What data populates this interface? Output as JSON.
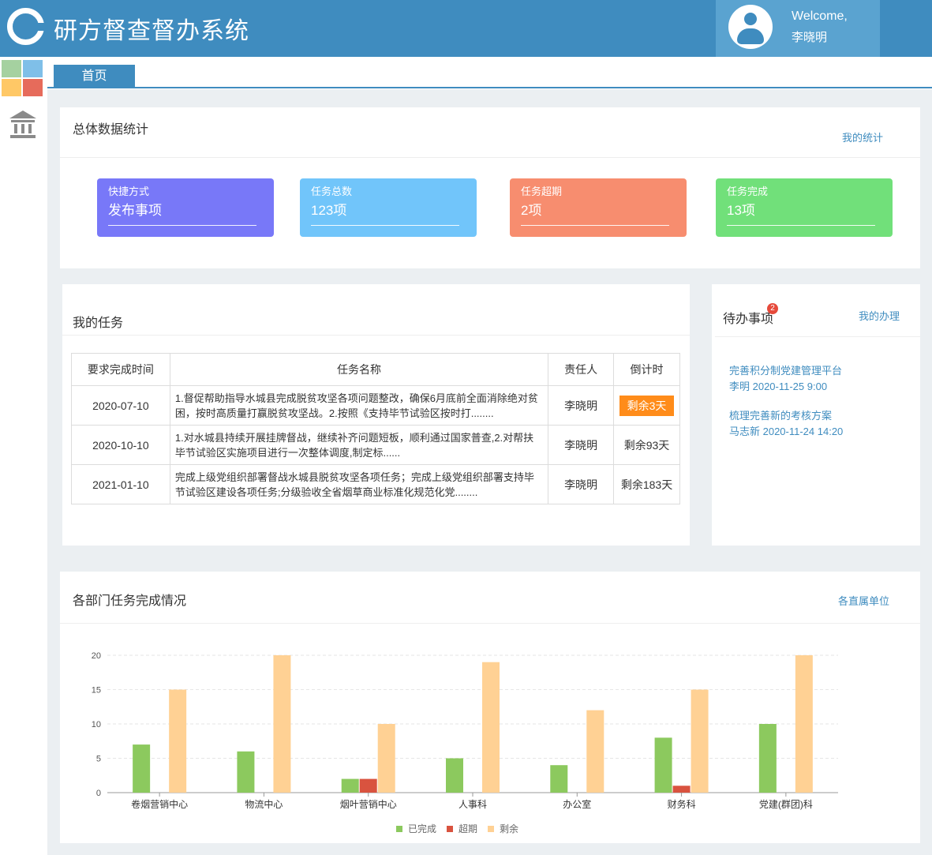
{
  "header": {
    "title": "研方督查督办系统",
    "welcome": "Welcome,",
    "username": "李晓明"
  },
  "tabs": [
    {
      "label": "首页"
    }
  ],
  "stats_panel": {
    "title": "总体数据统计",
    "link": "我的统计",
    "cards": [
      {
        "label": "快捷方式",
        "value": "发布事项",
        "color": "#7878f8"
      },
      {
        "label": "任务总数",
        "value": "123项",
        "color": "#71c5fa"
      },
      {
        "label": "任务超期",
        "value": "2项",
        "color": "#f78d6f"
      },
      {
        "label": "任务完成",
        "value": "13项",
        "color": "#71e07a"
      }
    ]
  },
  "tasks_panel": {
    "title": "我的任务",
    "columns": [
      "要求完成时间",
      "任务名称",
      "责任人",
      "倒计时"
    ],
    "rows": [
      {
        "date": "2020-07-10",
        "name": "1.督促帮助指导水城县完成脱贫攻坚各项问题整改，确保6月底前全面消除绝对贫困，按时高质量打赢脱贫攻坚战。2.按照《支持毕节试验区按时打........",
        "owner": "李晓明",
        "countdown": "剩余3天",
        "warn": true
      },
      {
        "date": "2020-10-10",
        "name": "1.对水城县持续开展挂牌督战，继续补齐问题短板，顺利通过国家普查,2.对帮扶毕节试验区实施项目进行一次整体调度,制定标......",
        "owner": "李晓明",
        "countdown": "剩余93天",
        "warn": false
      },
      {
        "date": "2021-01-10",
        "name": "完成上级党组织部署督战水城县脱贫攻坚各项任务；完成上级党组织部署支持毕节试验区建设各项任务;分级验收全省烟草商业标准化规范化党........",
        "owner": "李晓明",
        "countdown": "剩余183天",
        "warn": false
      }
    ]
  },
  "todo_panel": {
    "title": "待办事项",
    "badge": "2",
    "link": "我的办理",
    "items": [
      {
        "title": "完善积分制党建管理平台",
        "meta": "李明 2020-11-25 9:00"
      },
      {
        "title": "梳理完善新的考核方案",
        "meta": "马志新 2020-11-24 14:20"
      }
    ]
  },
  "chart_panel": {
    "title": "各部门任务完成情况",
    "link": "各直属单位"
  },
  "chart_data": {
    "type": "bar",
    "categories": [
      "卷烟营销中心",
      "物流中心",
      "烟叶营销中心",
      "人事科",
      "办公室",
      "财务科",
      "党建(群团)科"
    ],
    "series": [
      {
        "name": "已完成",
        "values": [
          7,
          6,
          2,
          5,
          4,
          8,
          10
        ],
        "color": "#8cc95e"
      },
      {
        "name": "超期",
        "values": [
          0,
          0,
          2,
          0,
          0,
          1,
          0
        ],
        "color": "#d9533f"
      },
      {
        "name": "剩余",
        "values": [
          15,
          20,
          10,
          19,
          12,
          15,
          20
        ],
        "color": "#ffd194"
      }
    ],
    "yticks": [
      "0",
      "5",
      "10",
      "15",
      "20"
    ],
    "ylim": [
      0,
      20
    ],
    "grid": true,
    "legend_position": "bottom-center"
  }
}
